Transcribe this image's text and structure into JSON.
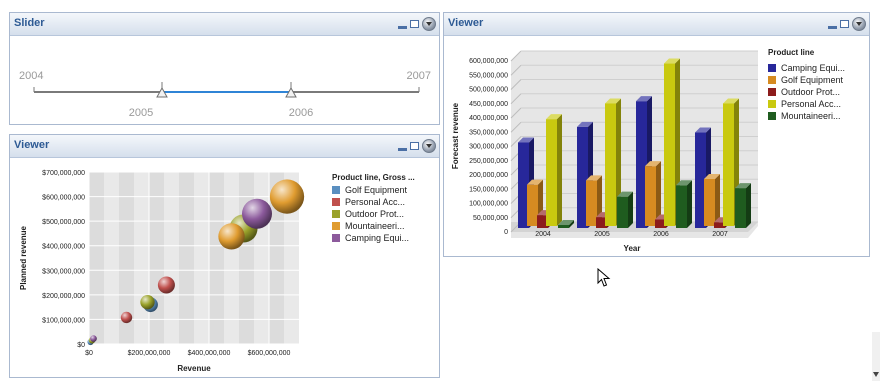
{
  "slider_panel": {
    "title": "Slider",
    "left_label": "2004",
    "right_label": "2007",
    "thumb1_label": "2005",
    "thumb2_label": "2006"
  },
  "scatter_panel": {
    "title": "Viewer",
    "chart_data": {
      "type": "scatter",
      "xlabel": "Revenue",
      "ylabel": "Planned revenue",
      "legend_title": "Product line, Gross ...",
      "xlim": [
        0,
        700000000
      ],
      "ylim": [
        0,
        700000000
      ],
      "x_ticks": [
        "$0",
        "$200,000,000",
        "$400,000,000",
        "$600,000,000"
      ],
      "y_ticks": [
        "$0",
        "$100,000,000",
        "$200,000,000",
        "$300,000,000",
        "$400,000,000",
        "$500,000,000",
        "$600,000,000",
        "$700,000,000"
      ],
      "series": [
        {
          "name": "Golf Equipment",
          "color": "#5a8fc0",
          "points": [
            [
              5000000,
              8000000
            ],
            [
              205000000,
              160000000
            ]
          ]
        },
        {
          "name": "Personal Acc...",
          "color": "#c0504d",
          "points": [
            [
              125000000,
              108000000
            ],
            [
              258000000,
              240000000
            ]
          ]
        },
        {
          "name": "Outdoor Prot...",
          "color": "#9aa22a",
          "points": [
            [
              10000000,
              15000000
            ],
            [
              195000000,
              170000000
            ],
            [
              515000000,
              470000000
            ]
          ]
        },
        {
          "name": "Mountaineeri...",
          "color": "#e09c30",
          "points": [
            [
              475000000,
              438000000
            ],
            [
              660000000,
              600000000
            ]
          ]
        },
        {
          "name": "Camping Equi...",
          "color": "#8c5a9c",
          "points": [
            [
              15000000,
              22000000
            ],
            [
              560000000,
              530000000
            ]
          ]
        }
      ]
    }
  },
  "bar_panel": {
    "title": "Viewer",
    "chart_data": {
      "type": "bar",
      "xlabel": "Year",
      "ylabel": "Forecast revenue",
      "legend_title": "Product line",
      "categories": [
        "2004",
        "2005",
        "2006",
        "2007"
      ],
      "ylim": [
        0,
        600000000
      ],
      "y_ticks": [
        "0",
        "50,000,000",
        "100,000,000",
        "150,000,000",
        "200,000,000",
        "250,000,000",
        "300,000,000",
        "350,000,000",
        "400,000,000",
        "450,000,000",
        "500,000,000",
        "550,000,000",
        "600,000,000"
      ],
      "series": [
        {
          "name": "Camping Equi...",
          "color": "#27279a",
          "values": [
            300000000,
            355000000,
            445000000,
            335000000
          ]
        },
        {
          "name": "Golf Equipment",
          "color": "#d68b21",
          "values": [
            145000000,
            160000000,
            210000000,
            165000000
          ]
        },
        {
          "name": "Outdoor Prot...",
          "color": "#8c1c1c",
          "values": [
            45000000,
            38000000,
            30000000,
            20000000
          ]
        },
        {
          "name": "Personal Acc...",
          "color": "#c9c90f",
          "values": [
            375000000,
            430000000,
            570000000,
            430000000
          ]
        },
        {
          "name": "Mountaineeri...",
          "color": "#1f5c1f",
          "values": [
            0,
            110000000,
            150000000,
            140000000
          ]
        }
      ]
    }
  }
}
